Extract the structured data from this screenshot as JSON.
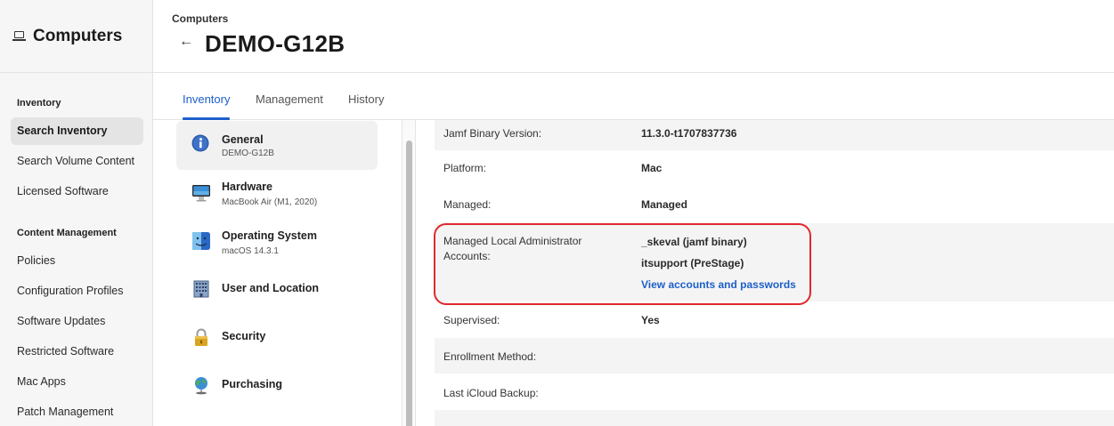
{
  "leftnav": {
    "title": "Computers",
    "icon": "laptop-icon",
    "sections": [
      {
        "label": "Inventory",
        "items": [
          {
            "label": "Search Inventory",
            "active": true
          },
          {
            "label": "Search Volume Content"
          },
          {
            "label": "Licensed Software"
          }
        ]
      },
      {
        "label": "Content Management",
        "items": [
          {
            "label": "Policies"
          },
          {
            "label": "Configuration Profiles"
          },
          {
            "label": "Software Updates"
          },
          {
            "label": "Restricted Software"
          },
          {
            "label": "Mac Apps"
          },
          {
            "label": "Patch Management"
          }
        ]
      }
    ]
  },
  "header": {
    "breadcrumb": "Computers",
    "back_icon": "back-arrow-icon",
    "title": "DEMO-G12B"
  },
  "tabs": [
    {
      "label": "Inventory",
      "active": true
    },
    {
      "label": "Management"
    },
    {
      "label": "History"
    }
  ],
  "categories": [
    {
      "title": "General",
      "subtitle": "DEMO-G12B",
      "icon": "info-icon",
      "active": true
    },
    {
      "title": "Hardware",
      "subtitle": "MacBook Air (M1, 2020)",
      "icon": "imac-icon"
    },
    {
      "title": "Operating System",
      "subtitle": "macOS 14.3.1",
      "icon": "finder-icon"
    },
    {
      "title": "User and Location",
      "subtitle": "",
      "icon": "building-icon"
    },
    {
      "title": "Security",
      "subtitle": "",
      "icon": "lock-icon"
    },
    {
      "title": "Purchasing",
      "subtitle": "",
      "icon": "globe-icon"
    }
  ],
  "details": [
    {
      "label": "Jamf Binary Version:",
      "values": [
        "11.3.0-t1707837736"
      ]
    },
    {
      "label": "Platform:",
      "values": [
        "Mac"
      ]
    },
    {
      "label": "Managed:",
      "values": [
        "Managed"
      ]
    },
    {
      "label": "Managed Local Administrator Accounts:",
      "values": [
        "_skeval (jamf binary)",
        "itsupport (PreStage)"
      ],
      "link": "View accounts and passwords"
    },
    {
      "label": "Supervised:",
      "values": [
        "Yes"
      ]
    },
    {
      "label": "Enrollment Method:",
      "values": []
    },
    {
      "label": "Last iCloud Backup:",
      "values": []
    }
  ],
  "colors": {
    "accent": "#1d5fc9",
    "highlight": "#e0282e"
  }
}
